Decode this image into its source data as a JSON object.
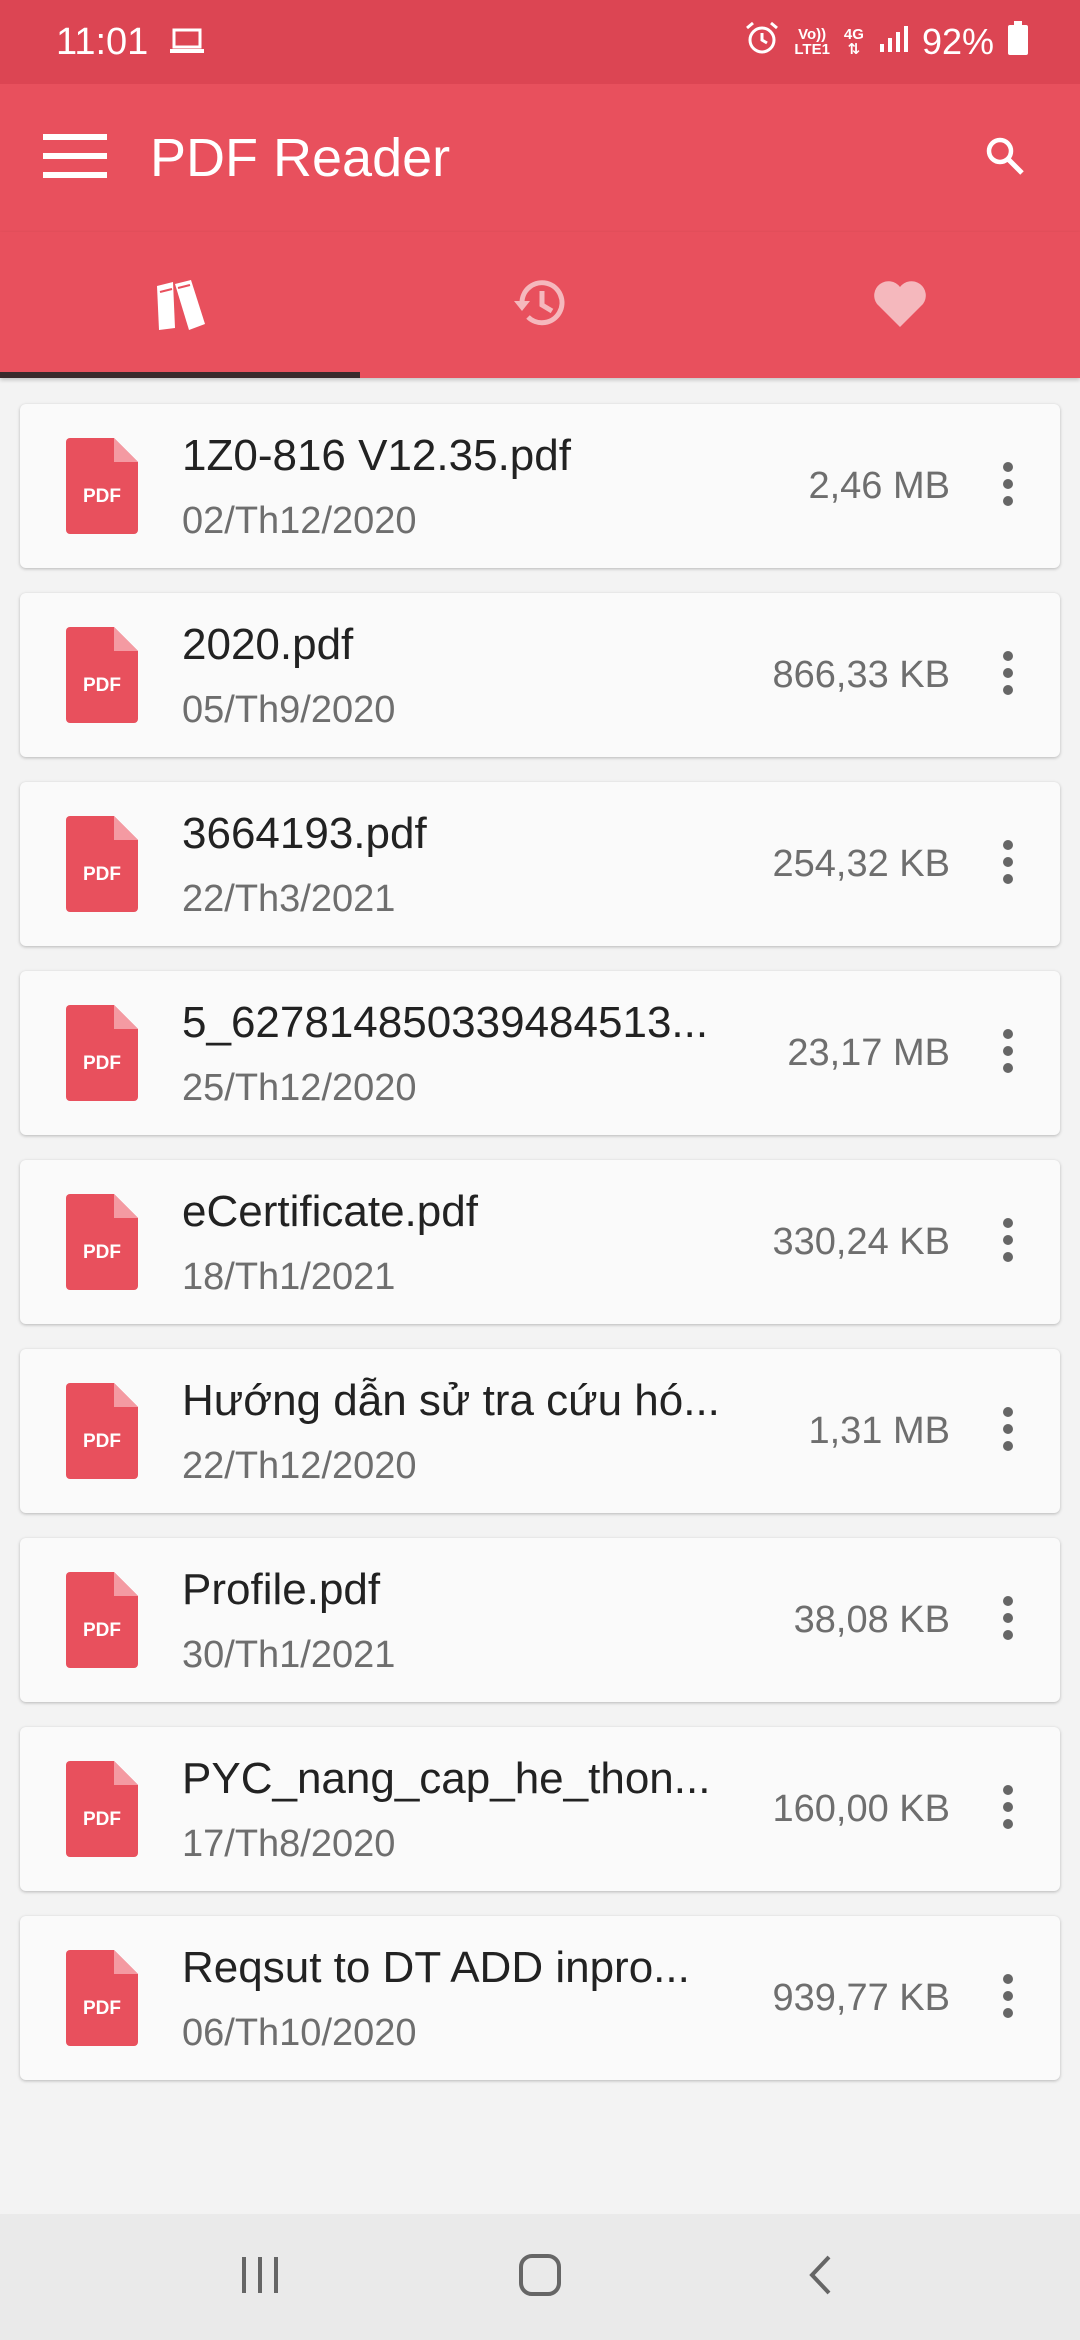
{
  "status_bar": {
    "time": "11:01",
    "volte_line1": "Vo))",
    "volte_line2": "LTE1",
    "network": "4G",
    "battery": "92%"
  },
  "app_bar": {
    "title": "PDF Reader"
  },
  "tabs": [
    {
      "icon": "books-icon",
      "active": true
    },
    {
      "icon": "history-icon",
      "active": false
    },
    {
      "icon": "heart-icon",
      "active": false
    }
  ],
  "files": [
    {
      "name": "1Z0-816 V12.35.pdf",
      "date": "02/Th12/2020",
      "size": "2,46 MB"
    },
    {
      "name": "2020.pdf",
      "date": "05/Th9/2020",
      "size": "866,33 KB"
    },
    {
      "name": "3664193.pdf",
      "date": "22/Th3/2021",
      "size": "254,32 KB"
    },
    {
      "name": "5_627814850339484513...",
      "date": "25/Th12/2020",
      "size": "23,17 MB"
    },
    {
      "name": "eCertificate.pdf",
      "date": "18/Th1/2021",
      "size": "330,24 KB"
    },
    {
      "name": "Hướng dẫn sử tra cứu hó...",
      "date": "22/Th12/2020",
      "size": "1,31 MB"
    },
    {
      "name": "Profile.pdf",
      "date": "30/Th1/2021",
      "size": "38,08 KB"
    },
    {
      "name": "PYC_nang_cap_he_thon...",
      "date": "17/Th8/2020",
      "size": "160,00 KB"
    },
    {
      "name": "Reqsut to DT ADD inpro...",
      "date": "06/Th10/2020",
      "size": "939,77 KB"
    }
  ],
  "pdf_icon_label": "PDF",
  "colors": {
    "status_bar": "#dc4553",
    "app_bar": "#e8505d",
    "pdf_icon": "#e8505d",
    "background": "#f3f3f3"
  }
}
